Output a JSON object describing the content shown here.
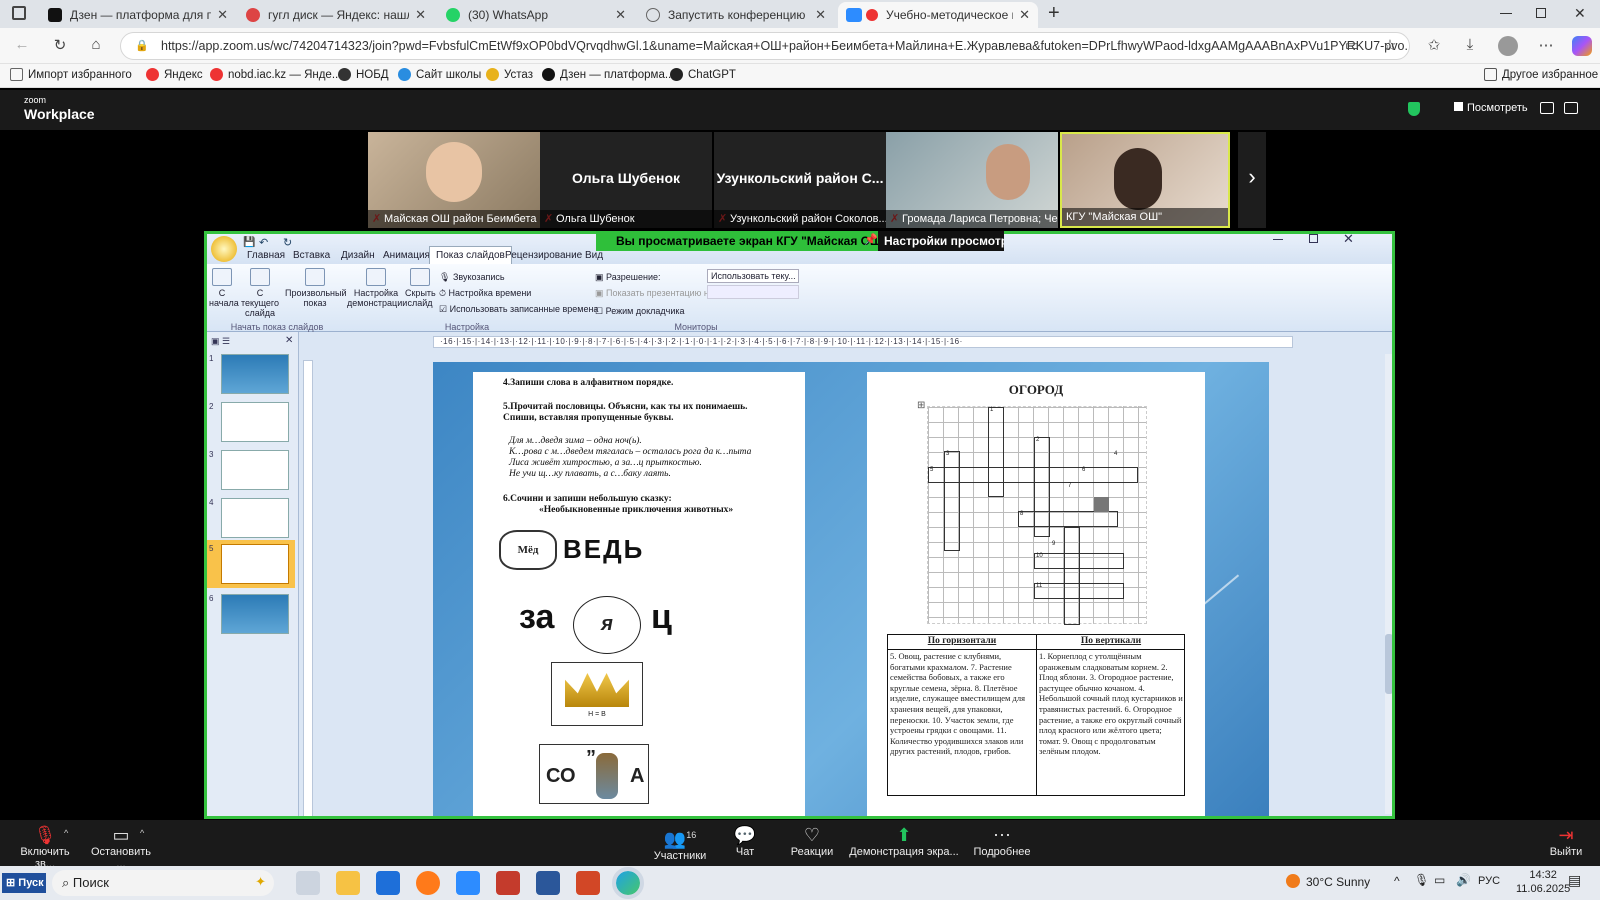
{
  "browser": {
    "tabs": [
      {
        "label": "Дзен — платформа для просмо",
        "color": "#111"
      },
      {
        "label": "гугл диск — Яндекс: нашлось 83",
        "color": "#d44"
      },
      {
        "label": "(30) WhatsApp",
        "color": "#25d366"
      },
      {
        "label": "Запустить конференцию - Zoom",
        "color": "#888"
      },
      {
        "label": "Учебно-методическое пос",
        "color": "#e33"
      }
    ],
    "new_tab": "+",
    "url": "https://app.zoom.us/wc/74204714323/join?pwd=FvbsfulCmEtWf9xOP0bdVQrvqdhwGl.1&uname=Майская+ОШ+район+Беимбета+Майлина+Е.Журавлева&futoken=DPrLfhwyWPaod-ldxgAAMgAAABnAxPVu1PYRKU7-pvo...",
    "bookmarks": [
      {
        "label": "Импорт избранного",
        "color": "#666"
      },
      {
        "label": "Яндекс",
        "color": "#e33"
      },
      {
        "label": "nobd.iac.kz — Янде...",
        "color": "#e33"
      },
      {
        "label": "НОБД",
        "color": "#333"
      },
      {
        "label": "Сайт школы",
        "color": "#2a8de0"
      },
      {
        "label": "Устаз",
        "color": "#e8b21c"
      },
      {
        "label": "Дзен — платформа...",
        "color": "#111"
      },
      {
        "label": "ChatGPT",
        "color": "#222"
      }
    ],
    "other_bookmarks": "Другое избранное"
  },
  "zoom": {
    "logo_top": "zoom",
    "logo_bottom": "Workplace",
    "view_button": "Посмотреть",
    "participants": [
      {
        "name": "Майская ОШ район Беимбета ...",
        "center": "",
        "muted": true
      },
      {
        "name": "Ольга Шубенок",
        "center": "Ольга Шубенок",
        "muted": true
      },
      {
        "name": "Узункольский район Соколов...",
        "center": "Узункольский район С...",
        "muted": true
      },
      {
        "name": "Громада Лариса Петровна; Че...",
        "center": "",
        "muted": true
      },
      {
        "name": "КГУ \"Майская ОШ\"",
        "center": "",
        "muted": false
      }
    ],
    "share_banner": "Вы просматриваете экран  КГУ \"Майская ОШ\"",
    "share_settings": "Настройки просмотр",
    "toolbar": {
      "unmute": "Включить зв...",
      "stop_video": "Остановить ...",
      "participants": "Участники",
      "participants_count": "16",
      "chat": "Чат",
      "reactions": "Реакции",
      "share": "Демонстрация экра...",
      "more": "Подробнее",
      "leave": "Выйти"
    }
  },
  "ppt": {
    "tabs": [
      "Главная",
      "Вставка",
      "Дизайн",
      "Анимация",
      "Показ слайдов",
      "Рецензирование",
      "Вид"
    ],
    "active_tab": "Показ слайдов",
    "buttons": {
      "from_start": "С начала",
      "from_current": "С текущего слайда",
      "custom": "Произвольный показ",
      "setup": "Настройка демонстрации",
      "hide": "Скрыть слайд"
    },
    "options": {
      "record": "Звукозапись",
      "rehearse": "Настройка времени",
      "use_timings": "Использовать записанные времена",
      "resolution_label": "Разрешение:",
      "resolution_value": "Использовать теку...",
      "show_on": "Показать презентацию на:",
      "presenter": "Режим докладчика"
    },
    "groups": {
      "start": "Начать показ слайдов",
      "setup": "Настройка",
      "monitors": "Мониторы"
    },
    "ruler": "·16·|·15·|·14·|·13·|·12·|·11·|·10·|·9·|·8·|·7·|·6·|·5·|·4·|·3·|·2·|·1·|·0·|·1·|·2·|·3·|·4·|·5·|·6·|·7·|·8·|·9·|·10·|·11·|·12·|·13·|·14·|·15·|·16·",
    "thumb_numbers": [
      "1",
      "2",
      "3",
      "4",
      "5",
      "6"
    ],
    "left_page": {
      "task4": "4.Запиши слова в алфавитном порядке.",
      "task5a": "5.Прочитай пословицы. Объясни, как ты их понимаешь.",
      "task5b": "Спиши, вставляя пропущенные буквы.",
      "proverb1": "Для м…дведя зима – одна ноч(ь).",
      "proverb2": "К…рова с м…дведем тягалась – осталась рога да к…пыта",
      "proverb3": "Лиса живёт хитростью, а за…ц прыткостью.",
      "proverb4": "Не учи щ…ку плавать, а с…баку лаять.",
      "task6a": "6.Сочини и запиши небольшую сказку:",
      "task6b": "«Необыкновенные приключения животных»",
      "pot_label": "Мёд",
      "rebus1": "ВЕДЬ",
      "rebus2a": "за",
      "rebus2b": "я",
      "rebus2c": "ц",
      "crown_caption": "Н = В",
      "rebus3a": "СО",
      "rebus3b": "А",
      "rebus3c": "”"
    },
    "right_page": {
      "title": "ОГОРОД",
      "col_h": "По горизонтали",
      "col_v": "По вертикали",
      "horizontal": "5. Овощ, растение с клубнями, богатыми крахмалом. 7. Растение семейства бобовых, а также его круглые семена, зёрна. 8. Плетёное изделие, служащее вместилищем для хранения вещей, для упаковки, переноски. 10. Участок земли, где устроены грядки с овощами. 11. Количество уродившихся злаков или других растений, плодов, грибов.",
      "vertical": "1. Корнеплод с утолщённым оранжевым сладковатым корнем. 2. Плод яблони. 3. Огородное растение, растущее обычно кочаном. 4. Небольшой сочный плод кустарников и травянистых растений. 6. Огородное растение, а также его округлый сочный плод красного или жёлтого цвета; томат. 9. Овощ с продолговатым зелёным плодом.",
      "grid_numbers": [
        "1",
        "2",
        "3",
        "4",
        "5",
        "6",
        "7",
        "8",
        "9",
        "10",
        "11"
      ]
    }
  },
  "taskbar": {
    "start": "Пуск",
    "search": "Поиск",
    "weather": "30°C  Sunny",
    "lang": "РУС",
    "time": "14:32",
    "date": "11.06.2025"
  }
}
